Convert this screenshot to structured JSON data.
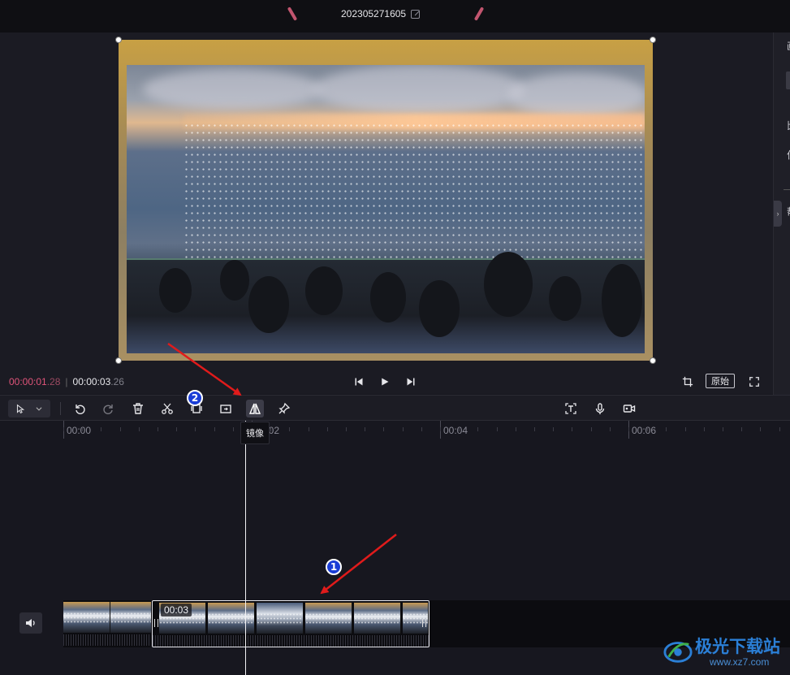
{
  "title_bar": {
    "project_name": "202305271605"
  },
  "preview": {
    "description_icons": [
      "edit-icon"
    ]
  },
  "transport": {
    "current_time_main": "00:00:01",
    "current_time_frames": ".28",
    "total_time_main": "00:00:03",
    "total_time_frames": ".26",
    "original_ratio_label": "原始"
  },
  "right_panel": {
    "glyphs": [
      "画",
      "比",
      "位",
      "帮"
    ]
  },
  "toolbar": {
    "tools": [
      "select",
      "undo",
      "redo",
      "delete",
      "split",
      "freeze",
      "replace",
      "mirror",
      "pin"
    ],
    "right_tools": [
      "text-recognize",
      "voiceover",
      "record"
    ],
    "mirror_tooltip": "镜像"
  },
  "ruler": {
    "labels": [
      "00:00",
      "00:02",
      "00:04",
      "00:06"
    ]
  },
  "timeline": {
    "selected_clip_duration": "00:03"
  },
  "annotations": {
    "badge_1": "1",
    "badge_2": "2"
  },
  "watermark": {
    "brand": "极光下载站",
    "url": "www.xz7.com"
  },
  "colors": {
    "accent_pink": "#e0547a",
    "annotation_red": "#e01b1b",
    "badge_blue": "#1a3dd6",
    "watermark_blue": "#2b7fd6"
  }
}
